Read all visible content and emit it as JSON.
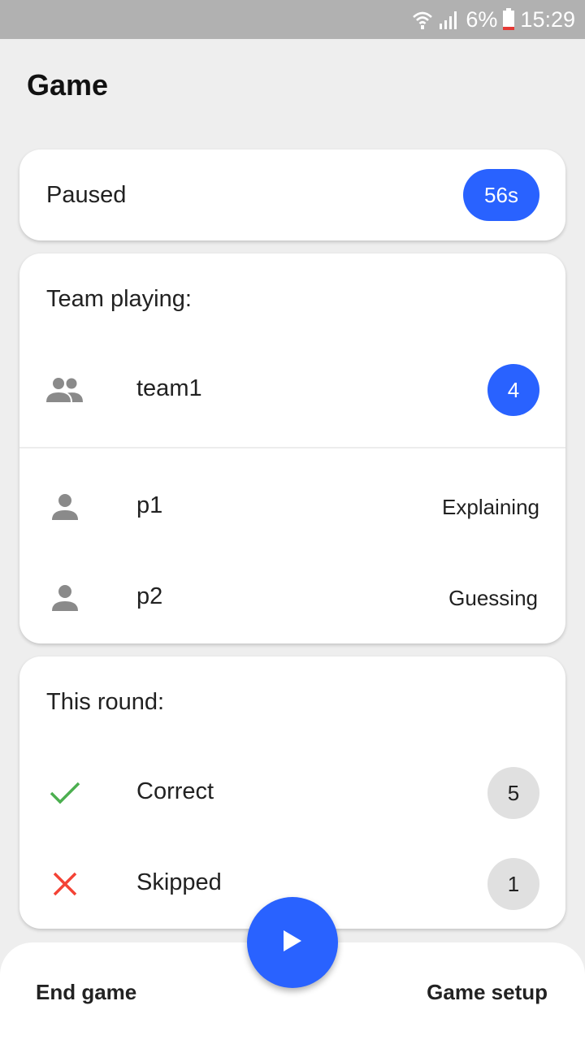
{
  "status_bar": {
    "battery_percent": "6%",
    "time": "15:29",
    "icons": [
      "wifi-icon",
      "signal-icon",
      "battery-low-icon"
    ]
  },
  "app_bar": {
    "title": "Game"
  },
  "status_card": {
    "state": "Paused",
    "timer": "56s"
  },
  "team_card": {
    "title": "Team playing:",
    "team": {
      "name": "team1",
      "score": "4",
      "icon": "group-icon"
    },
    "players": [
      {
        "name": "p1",
        "role": "Explaining",
        "icon": "person-icon"
      },
      {
        "name": "p2",
        "role": "Guessing",
        "icon": "person-icon"
      }
    ]
  },
  "round_card": {
    "title": "This round:",
    "rows": [
      {
        "label": "Correct",
        "count": "5",
        "icon": "check-icon"
      },
      {
        "label": "Skipped",
        "count": "1",
        "icon": "close-icon"
      }
    ]
  },
  "bottom_bar": {
    "left_label": "End game",
    "right_label": "Game setup",
    "fab_icon": "play-icon"
  },
  "colors": {
    "accent": "#2962ff",
    "correct": "#4caf50",
    "skipped": "#f44336",
    "icon_grey": "#8a8a8a"
  }
}
